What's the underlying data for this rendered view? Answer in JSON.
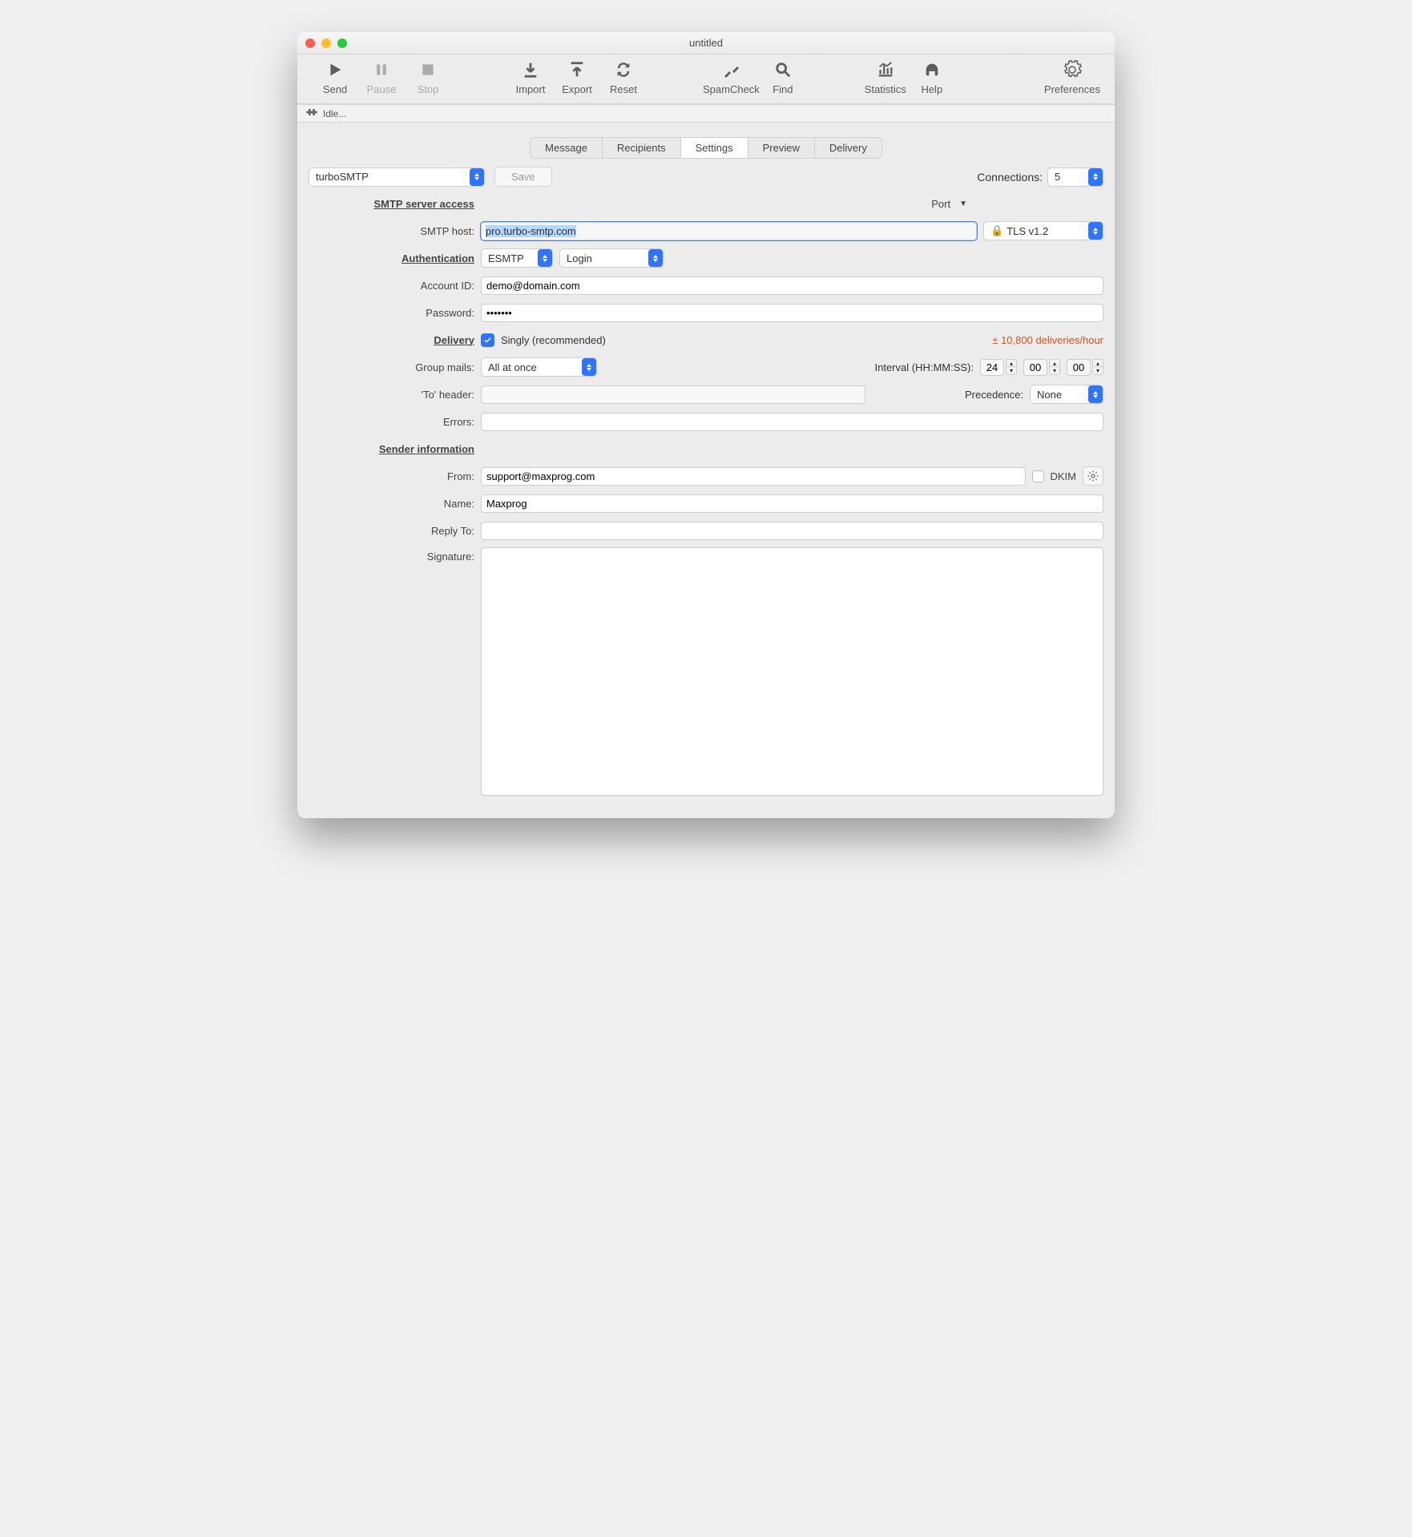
{
  "window": {
    "title": "untitled"
  },
  "toolbar": {
    "send": "Send",
    "pause": "Pause",
    "stop": "Stop",
    "import": "Import",
    "export": "Export",
    "reset": "Reset",
    "spamcheck": "SpamCheck",
    "find": "Find",
    "statistics": "Statistics",
    "help": "Help",
    "preferences": "Preferences"
  },
  "status": {
    "text": "Idle..."
  },
  "tabs": {
    "message": "Message",
    "recipients": "Recipients",
    "settings": "Settings",
    "preview": "Preview",
    "delivery": "Delivery"
  },
  "account": {
    "selected": "turboSMTP",
    "save": "Save"
  },
  "connections": {
    "label": "Connections:",
    "value": "5"
  },
  "sections": {
    "smtpAccess": "SMTP server access",
    "authentication": "Authentication",
    "delivery": "Delivery",
    "senderInfo": "Sender information"
  },
  "labels": {
    "smtpHost": "SMTP host:",
    "port": "Port",
    "accountId": "Account ID:",
    "password": "Password:",
    "groupMails": "Group mails:",
    "interval": "Interval (HH:MM:SS):",
    "toHeader": "'To' header:",
    "precedence": "Precedence:",
    "errors": "Errors:",
    "from": "From:",
    "name": "Name:",
    "replyTo": "Reply To:",
    "signature": "Signature:",
    "dkim": "DKIM",
    "singly": "Singly (recommended)"
  },
  "values": {
    "smtpHost": "pro.turbo-smtp.com",
    "tls": "TLS v1.2",
    "authMode": "ESMTP",
    "authType": "Login",
    "accountId": "demo@domain.com",
    "password": "•••••••",
    "rate": "± 10,800 deliveries/hour",
    "groupMails": "All at once",
    "intervalH": "24",
    "intervalM": "00",
    "intervalS": "00",
    "toHeader": "",
    "precedence": "None",
    "errors": "",
    "from": "support@maxprog.com",
    "name": "Maxprog",
    "replyTo": "",
    "signature": ""
  }
}
